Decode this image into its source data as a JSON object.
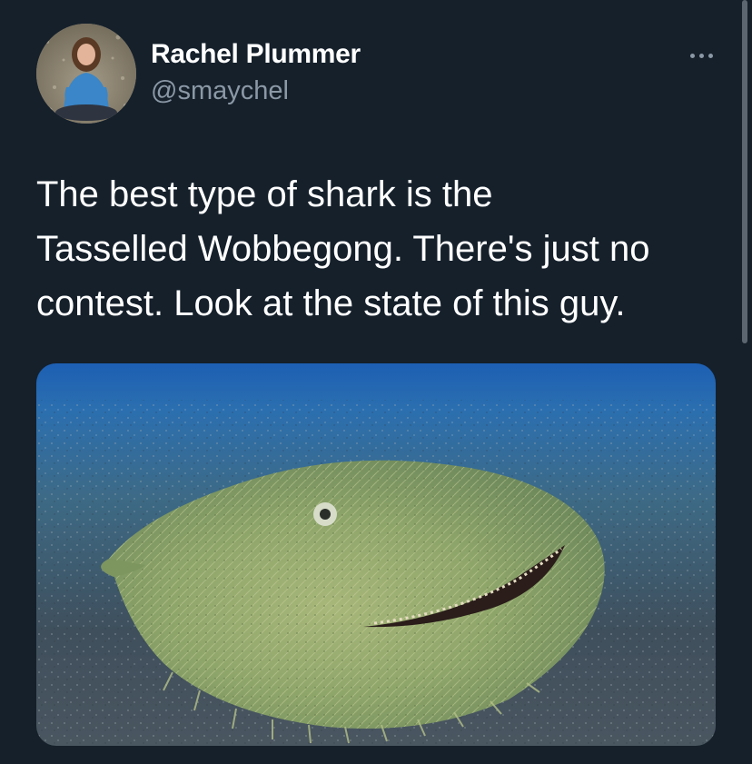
{
  "tweet": {
    "author_name": "Rachel Plummer",
    "author_handle": "@smaychel",
    "text": "The best type of shark is the\nTasselled Wobbegong. There's just no\ncontest. Look at the state of this guy.",
    "avatar_icon": "profile-photo",
    "more_icon": "more-horizontal-icon",
    "media_alt_subject": "tasselled-wobbegong-photo"
  },
  "colors": {
    "background": "#15202b",
    "primary_text": "#ffffff",
    "secondary_text": "#8b98a5"
  }
}
